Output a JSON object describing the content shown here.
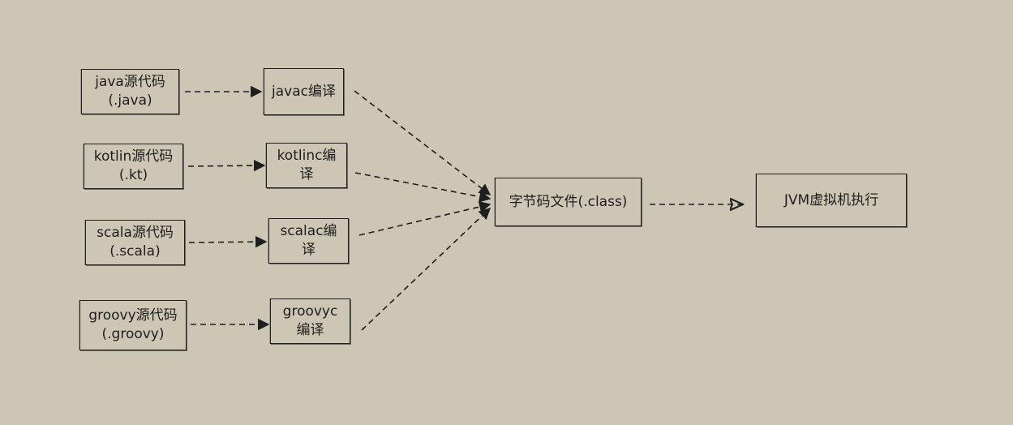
{
  "diagram": {
    "sources": [
      {
        "label": "java源代码\n(.java)"
      },
      {
        "label": "kotlin源代码\n(.kt)"
      },
      {
        "label": "scala源代码\n(.scala)"
      },
      {
        "label": "groovy源代码\n(.groovy)"
      }
    ],
    "compilers": [
      {
        "label": "javac编译"
      },
      {
        "label": "kotlinc编\n译"
      },
      {
        "label": "scalac编\n译"
      },
      {
        "label": "groovyc\n编译"
      }
    ],
    "bytecode": {
      "label": "字节码文件(.class)"
    },
    "jvm": {
      "label": "JVM虚拟机执行"
    }
  }
}
